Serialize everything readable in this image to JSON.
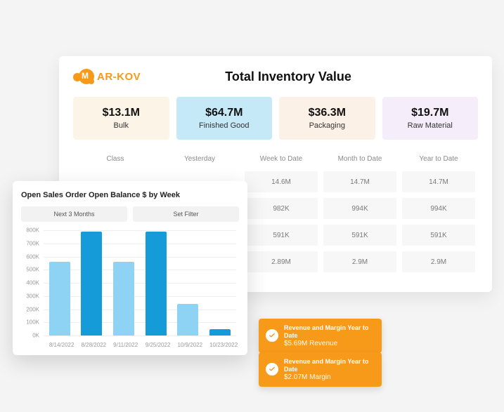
{
  "logo": {
    "text": "AR-KOV"
  },
  "header": {
    "title": "Total Inventory Value"
  },
  "kpi_cards": [
    {
      "value": "$13.1M",
      "label": "Bulk"
    },
    {
      "value": "$64.7M",
      "label": "Finished Good"
    },
    {
      "value": "$36.3M",
      "label": "Packaging"
    },
    {
      "value": "$19.7M",
      "label": "Raw Material"
    }
  ],
  "table": {
    "headers": [
      "Class",
      "Yesterday",
      "Week to Date",
      "Month to Date",
      "Year to Date"
    ],
    "rows": [
      [
        "",
        "",
        "14.6M",
        "14.7M",
        "14.7M"
      ],
      [
        "",
        "",
        "982K",
        "994K",
        "994K"
      ],
      [
        "",
        "",
        "591K",
        "591K",
        "591K"
      ],
      [
        "",
        "",
        "2.89M",
        "2.9M",
        "2.9M"
      ]
    ]
  },
  "chart": {
    "title": "Open Sales Order Open Balance $ by Week",
    "buttons": {
      "range": "Next 3 Months",
      "filter": "Set Filter"
    }
  },
  "chart_data": {
    "type": "bar",
    "title": "Open Sales Order Open Balance $ by Week",
    "categories": [
      "8/14/2022",
      "8/28/2022",
      "9/11/2022",
      "9/25/2022",
      "10/9/2022",
      "10/23/2022"
    ],
    "values": [
      560000,
      790000,
      560000,
      790000,
      240000,
      50000
    ],
    "colors": [
      "light",
      "dark",
      "light",
      "dark",
      "light",
      "dark"
    ],
    "xlabel": "",
    "ylabel": "",
    "ylim": [
      0,
      800000
    ],
    "y_ticks": [
      "800K",
      "700K",
      "600K",
      "500K",
      "400K",
      "300K",
      "200K",
      "100K",
      "0K"
    ]
  },
  "kpi_pills": [
    {
      "title": "Revenue and Margin Year to Date",
      "value": "$5.69M Revenue"
    },
    {
      "title": "Revenue and Margin Year to Date",
      "value": "$2.07M Margin"
    }
  ]
}
